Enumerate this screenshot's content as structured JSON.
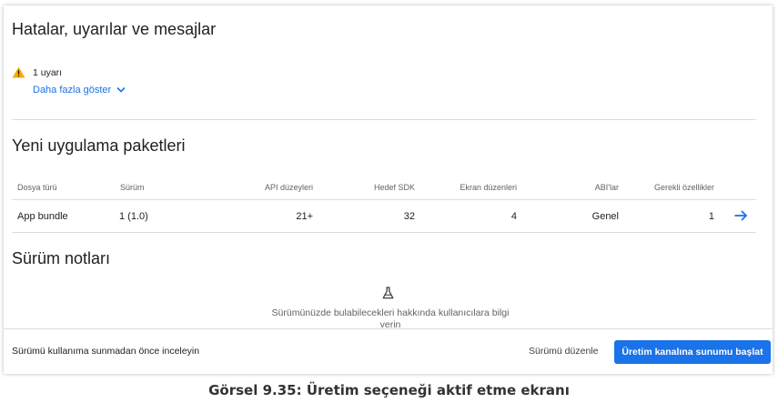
{
  "errors_section": {
    "title": "Hatalar, uyarılar ve mesajlar",
    "warning_text": "1 uyarı",
    "show_more": "Daha fazla göster"
  },
  "packages_section": {
    "title": "Yeni uygulama paketleri",
    "headers": {
      "file_type": "Dosya türü",
      "version": "Sürüm",
      "api_levels": "API düzeyleri",
      "target_sdk": "Hedef SDK",
      "screen_layouts": "Ekran düzenleri",
      "abis": "ABI'lar",
      "required_features": "Gerekli özellikler"
    },
    "row": {
      "file_type": "App bundle",
      "version": "1 (1.0)",
      "api_levels": "21+",
      "target_sdk": "32",
      "screen_layouts": "4",
      "abis": "Genel",
      "required_features": "1"
    }
  },
  "notes_section": {
    "title": "Sürüm notları",
    "empty_line1": "Sürümünüzde bulabilecekleri hakkında kullanıcılara bilgi",
    "empty_line2": "verin"
  },
  "footer": {
    "text": "Sürümü kullanıma sunmadan önce inceleyin",
    "edit_label": "Sürümü düzenle",
    "start_label": "Üretim kanalına sunumu başlat"
  },
  "caption": "Görsel 9.35: Üretim seçeneği aktif etme ekranı",
  "icons": {
    "warning": "warning-triangle-icon",
    "chevron": "chevron-down-icon",
    "arrow": "arrow-right-icon",
    "notes": "flask-icon"
  },
  "colors": {
    "accent": "#1a73e8",
    "warning": "#f9ab00"
  }
}
